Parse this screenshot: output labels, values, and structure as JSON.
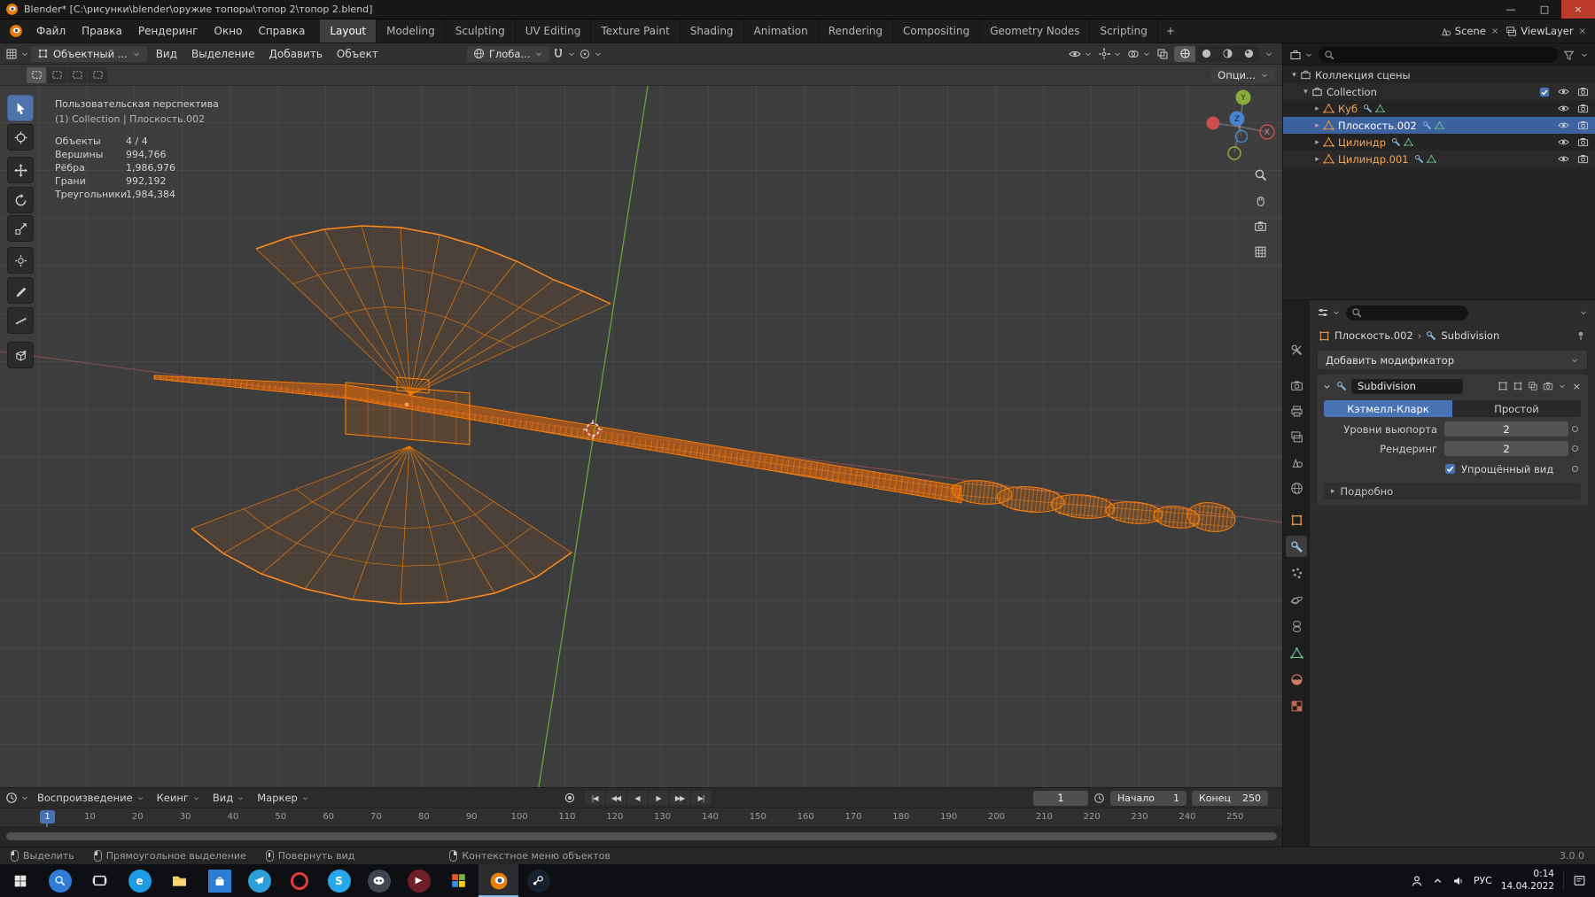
{
  "colors": {
    "accent": "#4772b3",
    "wire_orange": "#ff7f00",
    "selected_row": "#3d62a0",
    "selected_text": "#f0a860",
    "axis_green": "#6fae3c",
    "axis_red": "#c25c5c"
  },
  "window": {
    "title": "Blender* [C:\\рисунки\\blender\\оружие топоры\\топор 2\\топор 2.blend]",
    "minimize": "—",
    "maximize": "□",
    "close": "×"
  },
  "topbar": {
    "menus": [
      "Файл",
      "Правка",
      "Рендеринг",
      "Окно",
      "Справка"
    ],
    "workspaces": [
      "Layout",
      "Modeling",
      "Sculpting",
      "UV Editing",
      "Texture Paint",
      "Shading",
      "Animation",
      "Rendering",
      "Compositing",
      "Geometry Nodes",
      "Scripting"
    ],
    "active_workspace": "Layout",
    "add_tab": "+",
    "scene": "Scene",
    "view_layer": "ViewLayer"
  },
  "viewport": {
    "header": {
      "mode": "Объектный ...",
      "menus": [
        "Вид",
        "Выделение",
        "Добавить",
        "Объект"
      ],
      "orientation": "Глоба...",
      "options": "Опци..."
    },
    "toolbar": [
      "select",
      "cursor-3d",
      "move",
      "rotate",
      "scale",
      "transform",
      "annotate",
      "measure",
      "add-cube"
    ],
    "overlay": {
      "title": "Пользовательская перспектива",
      "subtitle": "(1) Collection | Плоскость.002",
      "stats": [
        {
          "label": "Объекты",
          "value": "4 / 4"
        },
        {
          "label": "Вершины",
          "value": "994,766"
        },
        {
          "label": "Рёбра",
          "value": "1,986,976"
        },
        {
          "label": "Грани",
          "value": "992,192"
        },
        {
          "label": "Треугольники",
          "value": "1,984,384"
        }
      ]
    },
    "axes": {
      "x": "X",
      "y": "Y",
      "z": "Z"
    }
  },
  "outliner": {
    "rows": [
      {
        "name": "Коллекция сцены",
        "type": "scene-collection",
        "indent": 0,
        "expander": "▾",
        "toggles": []
      },
      {
        "name": "Collection",
        "type": "collection",
        "indent": 1,
        "expander": "▾",
        "toggles": [
          "checkbox",
          "eye",
          "camera"
        ]
      },
      {
        "name": "Куб",
        "type": "mesh",
        "indent": 2,
        "expander": "▸",
        "selected": true,
        "toggles": [
          "eye",
          "camera"
        ]
      },
      {
        "name": "Плоскость.002",
        "type": "mesh",
        "indent": 2,
        "expander": "▸",
        "active": true,
        "toggles": [
          "eye",
          "camera"
        ]
      },
      {
        "name": "Цилиндр",
        "type": "mesh",
        "indent": 2,
        "expander": "▸",
        "selected": true,
        "toggles": [
          "eye",
          "camera"
        ]
      },
      {
        "name": "Цилиндр.001",
        "type": "mesh",
        "indent": 2,
        "expander": "▸",
        "selected": true,
        "toggles": [
          "eye",
          "camera"
        ]
      }
    ]
  },
  "properties": {
    "tabs": [
      "tool",
      "render",
      "output",
      "view-layer",
      "scene",
      "world",
      "object",
      "modifiers",
      "particles",
      "physics",
      "constraints",
      "object-data",
      "material",
      "texture"
    ],
    "active_tab": "modifiers",
    "breadcrumb": {
      "object": "Плоскость.002",
      "separator": "›",
      "modifier": "Subdivision"
    },
    "add_modifier": "Добавить модификатор",
    "modifier": {
      "name": "Subdivision",
      "types": [
        "Кэтмелл-Кларк",
        "Простой"
      ],
      "active_type": "Кэтмелл-Кларк",
      "fields": [
        {
          "label": "Уровни вьюпорта",
          "value": "2"
        },
        {
          "label": "Рендеринг",
          "value": "2"
        }
      ],
      "checkbox": "Упрощённый вид",
      "checkbox_checked": true,
      "subpanel": "Подробно"
    }
  },
  "timeline": {
    "menus": [
      "Воспроизведение",
      "Кеинг",
      "Вид",
      "Маркер"
    ],
    "current_frame": "1",
    "start_label": "Начало",
    "start_value": "1",
    "end_label": "Конец",
    "end_value": "250",
    "tick_start": 10,
    "tick_step": 10,
    "tick_end": 250,
    "playhead": "1"
  },
  "statusbar": {
    "hints": [
      "Выделить",
      "Прямоугольное выделение",
      "Повернуть вид",
      "Контекстное меню объектов"
    ],
    "version": "3.0.0"
  },
  "taskbar": {
    "apps": [
      "start",
      "search",
      "task-view",
      "edge",
      "explorer",
      "store",
      "telegram",
      "opera",
      "skype",
      "discord",
      "media-app",
      "photos",
      "blender",
      "steam"
    ],
    "active_app": "blender",
    "tray": {
      "language": "РУС",
      "time": "0:14",
      "date": "14.04.2022"
    }
  }
}
